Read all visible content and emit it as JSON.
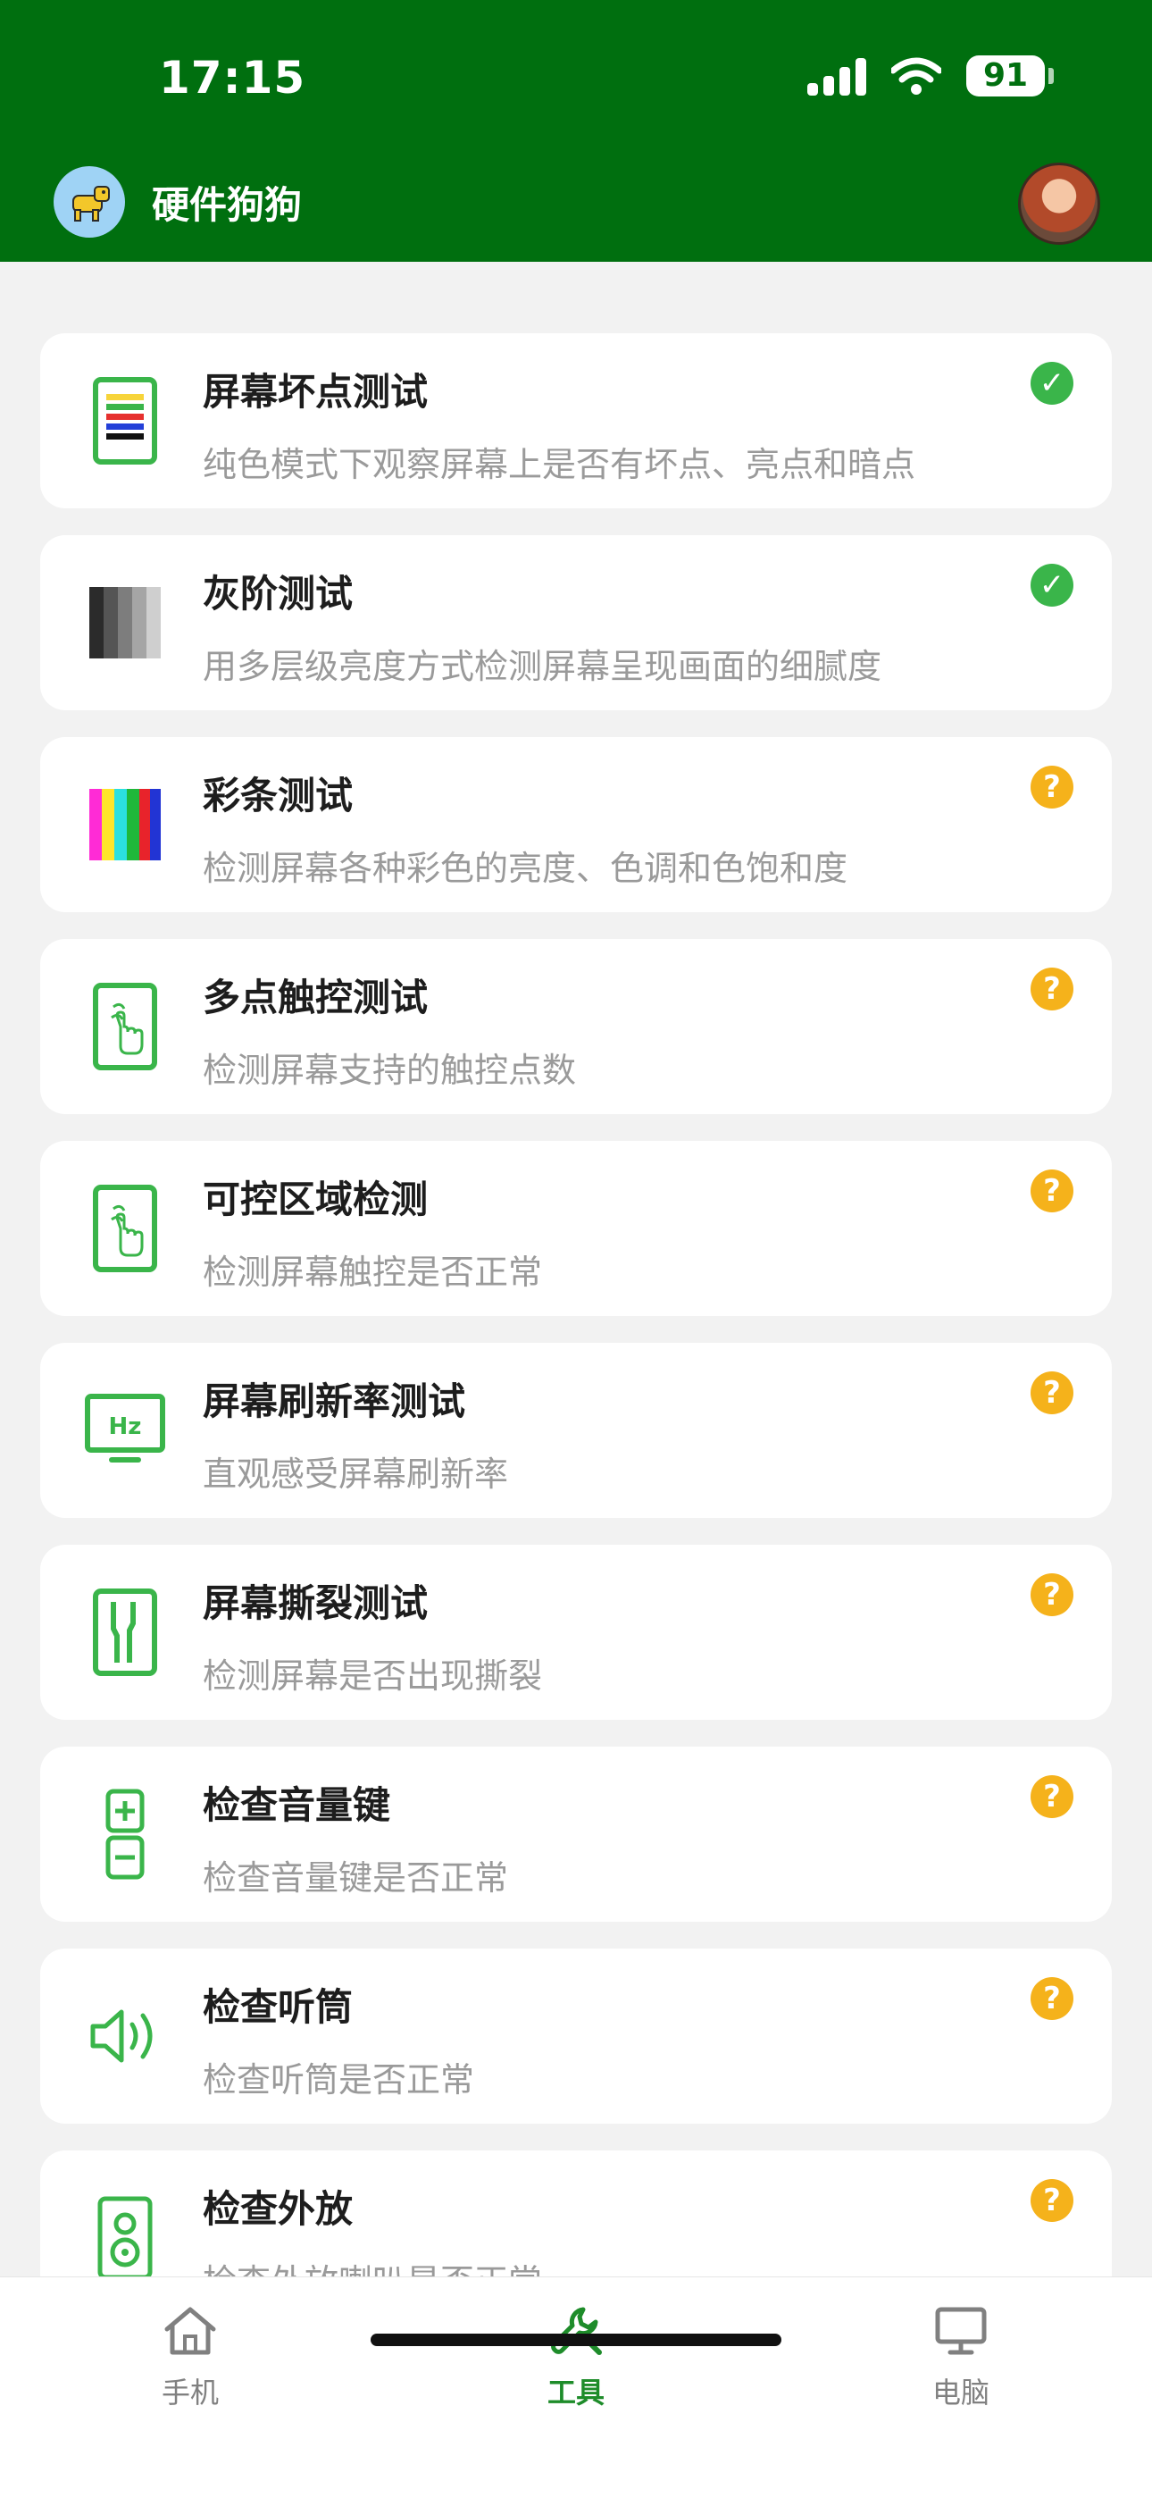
{
  "status_bar": {
    "time": "17:15",
    "battery": "91"
  },
  "header": {
    "title": "硬件狗狗"
  },
  "items": [
    {
      "title": "屏幕坏点测试",
      "desc": "纯色模式下观察屏幕上是否有坏点、亮点和暗点",
      "icon": "dead-pixel-icon",
      "status": "passed"
    },
    {
      "title": "灰阶测试",
      "desc": "用多层级亮度方式检测屏幕呈现画面的细腻度",
      "icon": "grayscale-icon",
      "status": "passed"
    },
    {
      "title": "彩条测试",
      "desc": "检测屏幕各种彩色的亮度、色调和色饱和度",
      "icon": "color-bars-icon",
      "status": "unknown"
    },
    {
      "title": "多点触控测试",
      "desc": "检测屏幕支持的触控点数",
      "icon": "multi-touch-icon",
      "status": "unknown"
    },
    {
      "title": "可控区域检测",
      "desc": "检测屏幕触控是否正常",
      "icon": "touch-area-icon",
      "status": "unknown"
    },
    {
      "title": "屏幕刷新率测试",
      "desc": "直观感受屏幕刷新率",
      "icon": "refresh-rate-icon",
      "status": "unknown"
    },
    {
      "title": "屏幕撕裂测试",
      "desc": "检测屏幕是否出现撕裂",
      "icon": "screen-tear-icon",
      "status": "unknown"
    },
    {
      "title": "检查音量键",
      "desc": "检查音量键是否正常",
      "icon": "volume-keys-icon",
      "status": "unknown"
    },
    {
      "title": "检查听筒",
      "desc": "检查听筒是否正常",
      "icon": "earpiece-icon",
      "status": "unknown"
    },
    {
      "title": "检查外放",
      "desc": "检查外放喇叭是否正常",
      "icon": "speaker-icon",
      "status": "unknown"
    }
  ],
  "tabs": [
    {
      "label": "手机",
      "icon": "home-icon",
      "active": false
    },
    {
      "label": "工具",
      "icon": "wrench-icon",
      "active": true
    },
    {
      "label": "电脑",
      "icon": "monitor-icon",
      "active": false
    }
  ],
  "colors": {
    "primary": "#006f0f",
    "accent": "#3ab54a",
    "pending": "#f5b21b",
    "text_secondary": "#9a9a9a"
  }
}
